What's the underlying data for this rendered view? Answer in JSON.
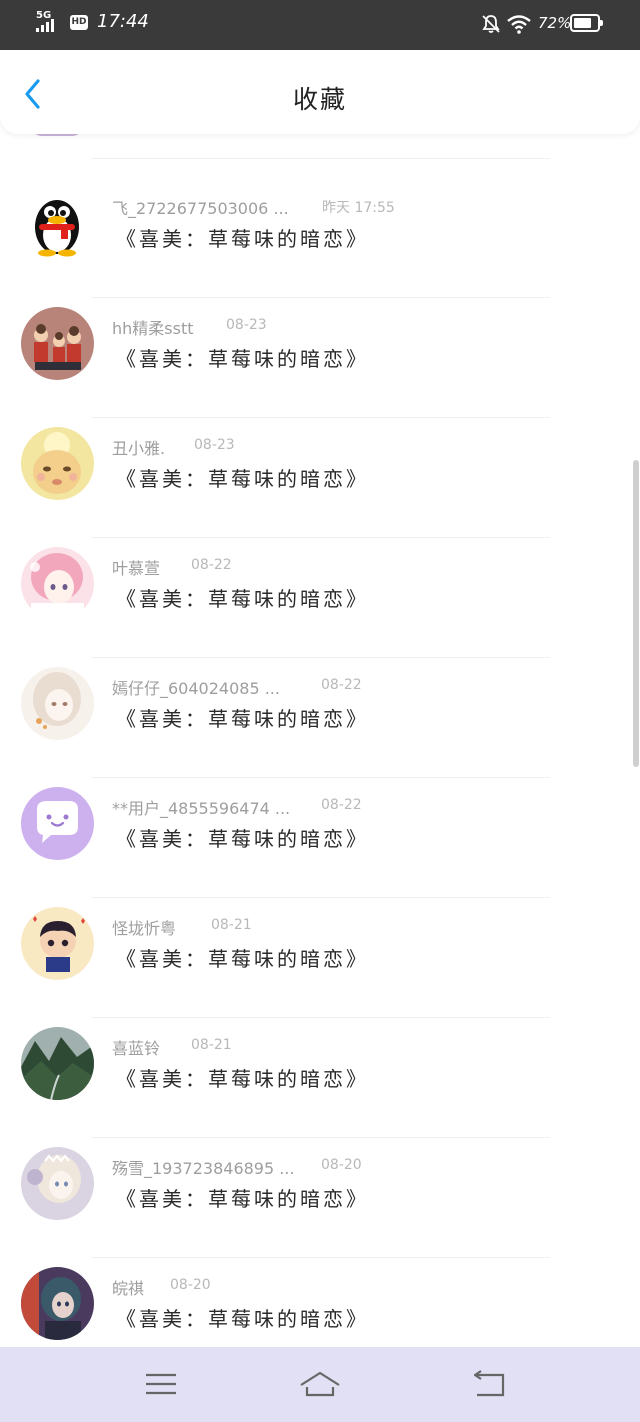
{
  "status_bar": {
    "network": "5G",
    "hd_badge": "HD",
    "time": "17:44",
    "battery_percent": "72%",
    "icons": [
      "signal-icon",
      "hd-icon",
      "mute-bell-icon",
      "wifi-icon",
      "battery-icon"
    ]
  },
  "header": {
    "back_icon": "chevron-left-icon",
    "title": "收藏"
  },
  "items": [
    {
      "name": "飞_2722677503006 ...",
      "time": "昨天 17:55",
      "message": "《喜美：草莓味的暗恋》",
      "avatar": "penguin"
    },
    {
      "name": "hh精柔sstt",
      "time": "08-23",
      "message": "《喜美：草莓味的暗恋》",
      "avatar": "family-cartoon"
    },
    {
      "name": "丑小雅.",
      "time": "08-23",
      "message": "《喜美：草莓味的暗恋》",
      "avatar": "yellow-cartoon"
    },
    {
      "name": "叶慕萱",
      "time": "08-22",
      "message": "《喜美：草莓味的暗恋》",
      "avatar": "pink-anime-girl"
    },
    {
      "name": "嫣仔仔_604024085 ...",
      "time": "08-22",
      "message": "《喜美：草莓味的暗恋》",
      "avatar": "anime-girl"
    },
    {
      "name": "**用户_4855596474 ...",
      "time": "08-22",
      "message": "《喜美：草莓味的暗恋》",
      "avatar": "chat-bubble"
    },
    {
      "name": "怪垅忻粤",
      "time": "08-21",
      "message": "《喜美：草莓味的暗恋》",
      "avatar": "cartoon-boy"
    },
    {
      "name": "喜蓝铃",
      "time": "08-21",
      "message": "《喜美：草莓味的暗恋》",
      "avatar": "mountain-landscape"
    },
    {
      "name": "殇雪_193723846895 ...",
      "time": "08-20",
      "message": "《喜美：草莓味的暗恋》",
      "avatar": "anime-princess"
    },
    {
      "name": "皖祺",
      "time": "08-20",
      "message": "《喜美：草莓味的暗恋》",
      "avatar": "anime-girl-dark"
    }
  ],
  "nav_bar": {
    "menu_icon": "menu-icon",
    "home_icon": "home-icon",
    "back_icon": "back-icon"
  },
  "colors": {
    "status_bar_bg": "#3a3a3a",
    "accent_blue": "#1a9bf0",
    "nav_bar_bg": "#e1e0f5",
    "name_gray": "#9e9e9e",
    "time_gray": "#b8b8b8"
  }
}
